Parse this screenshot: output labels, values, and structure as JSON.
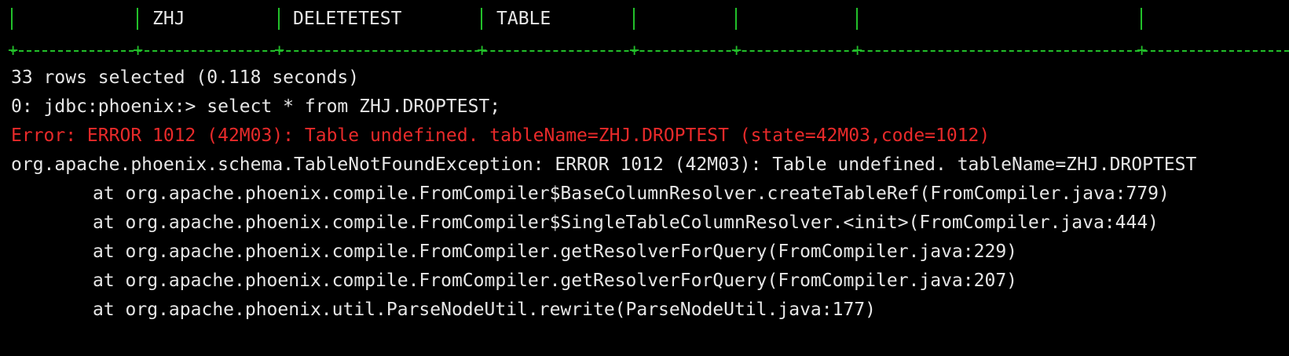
{
  "colors": {
    "background": "#000000",
    "text": "#e6e6e6",
    "border": "#22c02a",
    "error": "#e82a2a"
  },
  "table_row": {
    "cells": [
      "",
      "ZHJ",
      "DELETETEST",
      "TABLE",
      "",
      "",
      "",
      ""
    ]
  },
  "output": {
    "rows_selected": "33 rows selected (0.118 seconds)",
    "prompt_line": "0: jdbc:phoenix:> select * from ZHJ.DROPTEST;",
    "error_line": "Error: ERROR 1012 (42M03): Table undefined. tableName=ZHJ.DROPTEST (state=42M03,code=1012)",
    "exception_line": "org.apache.phoenix.schema.TableNotFoundException: ERROR 1012 (42M03): Table undefined. tableName=ZHJ.DROPTEST",
    "stack": [
      "at org.apache.phoenix.compile.FromCompiler$BaseColumnResolver.createTableRef(FromCompiler.java:779)",
      "at org.apache.phoenix.compile.FromCompiler$SingleTableColumnResolver.<init>(FromCompiler.java:444)",
      "at org.apache.phoenix.compile.FromCompiler.getResolverForQuery(FromCompiler.java:229)",
      "at org.apache.phoenix.compile.FromCompiler.getResolverForQuery(FromCompiler.java:207)",
      "at org.apache.phoenix.util.ParseNodeUtil.rewrite(ParseNodeUtil.java:177)"
    ]
  }
}
